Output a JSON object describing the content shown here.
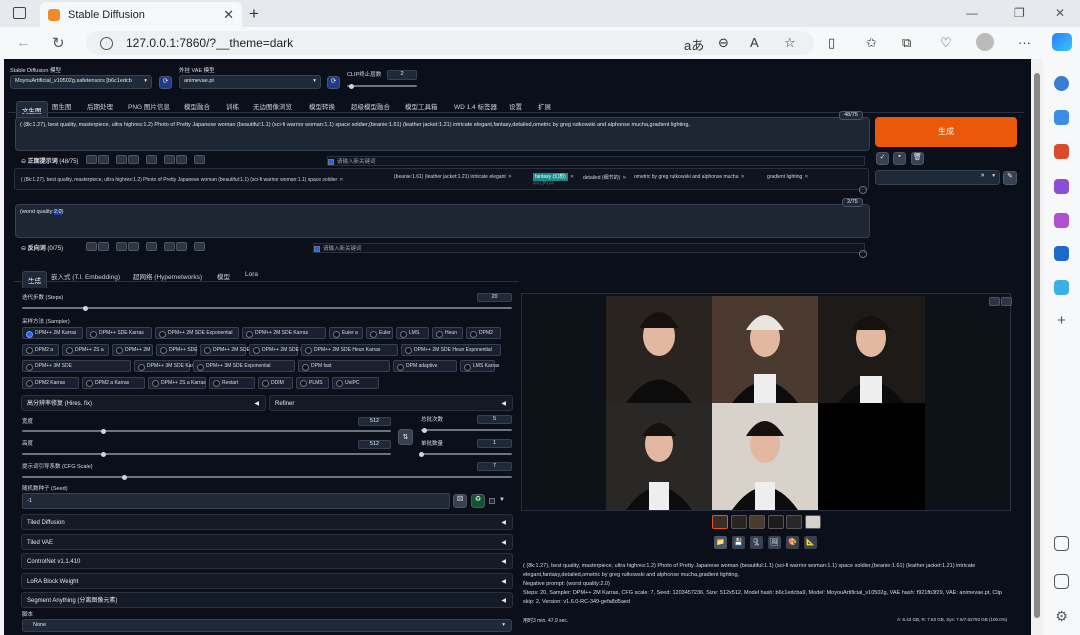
{
  "browser": {
    "tab_title": "Stable Diffusion",
    "url": "127.0.0.1:7860/?__theme=dark",
    "read_aloud": "aあ"
  },
  "top": {
    "model_label": "Stable Diffusion 模型",
    "model_value": "MoyouArtificial_v10502g.safetensors [b6c1edcb",
    "vae_label": "外挂 VAE 模型",
    "vae_value": "animevae.pt",
    "clip_label": "CLIP终止层数",
    "clip_value": "2"
  },
  "main_tabs": [
    "文生图",
    "图生图",
    "后期处理",
    "PNG 图片信息",
    "模型融合",
    "训练",
    "无边图像浏览",
    "模型转换",
    "超级模型融合",
    "模型工具箱",
    "WD 1.4 标签器",
    "设置",
    "扩展"
  ],
  "prompt": {
    "text": "( (8k:1.27), best quality, masterpiece, ultra highres:1.2) Photo of Pretty Japanese woman (beautiful:1.1) (sci-fi warrior woman:1.1) space soldier,(beanie:1.61) (leather jacket:1.21) intricate elegant,fantasy,detailed,ometric by greg rutkowski and alphonse mucha,gradient lighting,",
    "count": "48/75",
    "label": "正面提示词",
    "sub_count": "(48/75)",
    "search_placeholder": "请输入新关键词",
    "tokens": [
      {
        "t": "( (8k:1.27), best quality, masterpiece, ultra highres:1.2) Photo of Pretty Japanese woman (beautiful:1.1) (sci-fi warrior woman:1.1) space soldier",
        "s": "✕"
      },
      {
        "t": "(beanie:1.61) (leather jacket:1.21) intricate elegant",
        "s": "✕"
      },
      {
        "t": "fantasy (幻想)",
        "s": "✕",
        "sub": "奇幻,梦幻风"
      },
      {
        "t": "detailed (细节的)",
        "s": "✕"
      },
      {
        "t": "ometric by greg rutkowski and alphonse mucha",
        "s": "✕"
      },
      {
        "t": "gradient lighting",
        "s": "✕"
      }
    ]
  },
  "negative": {
    "text_pre": "(worst quality:",
    "text_num": "2.0",
    "text_post": ")",
    "count": "2/75",
    "label": "反向词",
    "sub_count": "(0/75)",
    "search_placeholder": "请输入新关键词"
  },
  "generate_label": "生成",
  "sub_tabs": [
    "生成",
    "嵌入式 (T.I. Embedding)",
    "超网络 (Hypernetworks)",
    "模型",
    "Lora"
  ],
  "steps": {
    "label": "迭代步数 (Steps)",
    "value": "20",
    "fraction": 0.13
  },
  "sampler": {
    "label": "采样方法 (Sampler)",
    "options": [
      "DPM++ 2M Karras",
      "DPM++ SDE Karras",
      "DPM++ 2M SDE Exponential",
      "DPM++ 2M SDE Karras",
      "Euler a",
      "Euler",
      "LMS",
      "Heun",
      "DPM2",
      "DPM2 a",
      "DPM++ 2S a",
      "DPM++ 2M",
      "DPM++ SDE",
      "DPM++ 2M SDE",
      "DPM++ 2M SDE Heun",
      "DPM++ 2M SDE Heun Karras",
      "DPM++ 2M SDE Heun Exponential",
      "DPM++ 3M SDE",
      "DPM++ 3M SDE Karras",
      "DPM++ 3M SDE Exponential",
      "DPM fast",
      "DPM adaptive",
      "LMS Karras",
      "DPM2 Karras",
      "DPM2 a Karras",
      "DPM++ 2S a Karras",
      "Restart",
      "DDIM",
      "PLMS",
      "UniPC",
      "LCM"
    ]
  },
  "hires": {
    "label": "高分辨率修复 (Hires. fix)"
  },
  "refiner": {
    "label": "Refiner"
  },
  "width": {
    "label": "宽度",
    "value": "512",
    "fraction": 0.22
  },
  "height": {
    "label": "高度",
    "value": "512",
    "fraction": 0.22
  },
  "batch_count": {
    "label": "总批次数",
    "value": "5",
    "fraction": 0.04
  },
  "batch_size": {
    "label": "单批数量",
    "value": "1",
    "fraction": 0.0
  },
  "cfg": {
    "label": "提示词引导系数 (CFG Scale)",
    "value": "7",
    "fraction": 0.21
  },
  "seed": {
    "label": "随机数种子 (Seed)",
    "value": "-1"
  },
  "accordions": [
    "Tiled Diffusion",
    "Tiled VAE",
    "ControlNet v1.1.410",
    "LoRA Block Weight",
    "Segment Anything (分离图像元素)"
  ],
  "script": {
    "label": "脚本",
    "value": "None"
  },
  "output": {
    "info_prompt": "( (8k:1.27), best quality, masterpiece, ultra highres:1.2) Photo of Pretty Japanese woman (beautiful:1.1) (sci-fi warrior woman:1.1) space soldier,(beanie:1.61) (leather jacket:1.21) intricate elegant,fantasy,detailed,ometric by greg rutkowski and alphonse mucha,gradient lighting,",
    "info_neg": "Negative prompt: (worst quality:2.0)",
    "info_params": "Steps: 20, Sampler: DPM++ 2M Karras, CFG scale: 7, Seed: 1203457236, Size: 512x512, Model hash: b6c1edcba9, Model: MoyouArtificial_v10502g, VAE hash: f921fb3f29, VAE: animevae.pt, Clip skip: 2, Version: v1.6.0-RC-349-gefa8d5aed",
    "time": "用时3 min. 47.9 sec.",
    "vram": "A: 6.43 GB, R: 7.63 GB, Sys: 7.6/7.62793 GB (100.0%)"
  },
  "colors": {
    "accent": "#ea580c",
    "bg": "#0b0f19",
    "panel": "#1f2937"
  }
}
